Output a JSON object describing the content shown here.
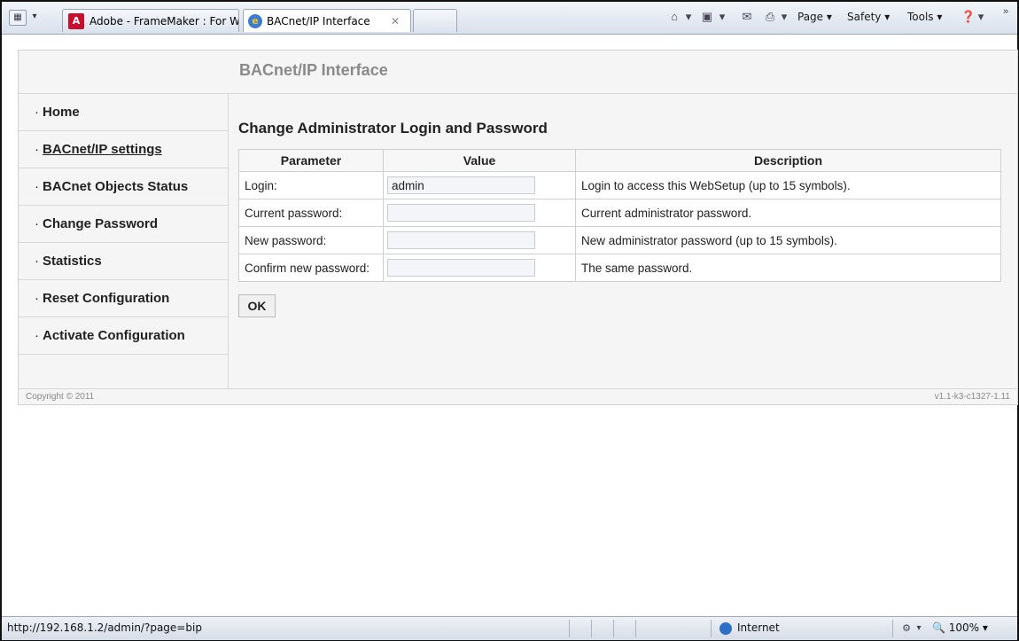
{
  "browser": {
    "tabs": [
      {
        "label": "Adobe - FrameMaker : For W..."
      },
      {
        "label": "BACnet/IP Interface"
      }
    ],
    "commands": {
      "page": "Page ▾",
      "safety": "Safety ▾",
      "tools": "Tools ▾"
    }
  },
  "page": {
    "title": "BACnet/IP Interface",
    "nav": [
      {
        "label": "Home"
      },
      {
        "label": "BACnet/IP settings"
      },
      {
        "label": "BACnet Objects Status"
      },
      {
        "label": "Change Password"
      },
      {
        "label": "Statistics"
      },
      {
        "label": "Reset Configuration"
      },
      {
        "label": "Activate Configuration"
      }
    ],
    "heading": "Change Administrator Login and Password",
    "table": {
      "headers": [
        "Parameter",
        "Value",
        "Description"
      ],
      "rows": [
        {
          "param": "Login:",
          "value": "admin",
          "desc": "Login to access this WebSetup (up to 15 symbols)."
        },
        {
          "param": "Current password:",
          "value": "",
          "desc": "Current administrator password."
        },
        {
          "param": "New password:",
          "value": "",
          "desc": "New administrator password (up to 15 symbols)."
        },
        {
          "param": "Confirm new password:",
          "value": "",
          "desc": "The same password."
        }
      ]
    },
    "ok_label": "OK",
    "copyright": "Copyright © 2011",
    "version": "v1.1-k3-c1327-1.11"
  },
  "status": {
    "url": "http://192.168.1.2/admin/?page=bip",
    "zone": "Internet",
    "zoom": "100%"
  }
}
